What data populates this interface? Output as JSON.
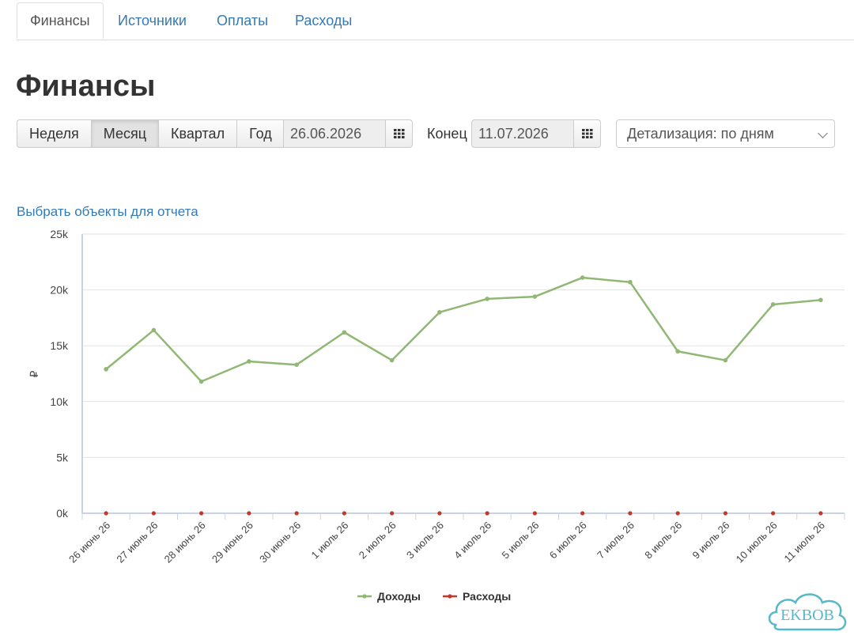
{
  "tabs": [
    "Финансы",
    "Источники",
    "Оплаты",
    "Расходы"
  ],
  "page_title": "Финансы",
  "periods": [
    "Неделя",
    "Месяц",
    "Квартал",
    "Год"
  ],
  "active_period": "Месяц",
  "start_date": "26.06.2026",
  "end_label": "Конец",
  "end_date": "11.07.2026",
  "detail_select": "Детализация: по дням",
  "select_objects_link": "Выбрать объекты для отчета",
  "watermark": "EKBOB",
  "colors": {
    "income": "#90b874",
    "expense": "#c0392b",
    "link": "#337ab7"
  },
  "chart_data": {
    "type": "line",
    "categories": [
      "26 июнь 26",
      "27 июнь 26",
      "28 июнь 26",
      "29 июнь 26",
      "30 июнь 26",
      "1 июль 26",
      "2 июль 26",
      "3 июль 26",
      "4 июль 26",
      "5 июль 26",
      "6 июль 26",
      "7 июль 26",
      "8 июль 26",
      "9 июль 26",
      "10 июль 26",
      "11 июль 26"
    ],
    "series": [
      {
        "name": "Доходы",
        "color": "#90b874",
        "values": [
          12900,
          16400,
          11800,
          13600,
          13300,
          16200,
          13700,
          18000,
          19200,
          19400,
          21100,
          20700,
          14500,
          13700,
          18700,
          19100
        ]
      },
      {
        "name": "Расходы",
        "color": "#c0392b",
        "values": [
          0,
          0,
          0,
          0,
          0,
          0,
          0,
          0,
          0,
          0,
          0,
          0,
          0,
          0,
          0,
          0
        ]
      }
    ],
    "ylabel": "₽",
    "yticks": [
      "0k",
      "5k",
      "10k",
      "15k",
      "20k",
      "25k"
    ],
    "ylim": [
      0,
      25000
    ],
    "grid": true,
    "legend": "bottom"
  }
}
